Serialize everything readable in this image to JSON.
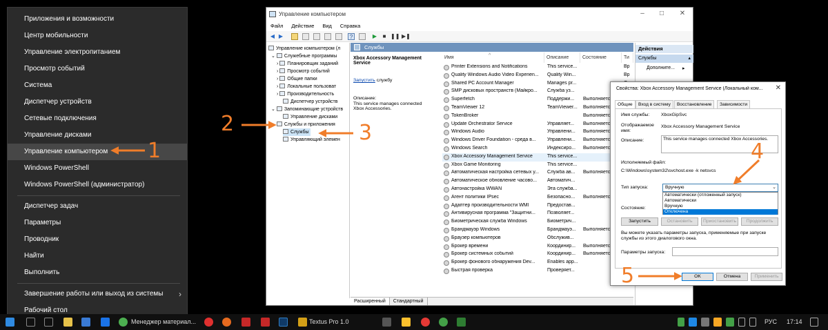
{
  "start_menu": {
    "items": [
      "Приложения и возможности",
      "Центр мобильности",
      "Управление электропитанием",
      "Просмотр событий",
      "Система",
      "Диспетчер устройств",
      "Сетевые подключения",
      "Управление дисками",
      "Управление компьютером",
      "Windows PowerShell",
      "Windows PowerShell (администратор)",
      "Диспетчер задач",
      "Параметры",
      "Проводник",
      "Найти",
      "Выполнить",
      "Завершение работы или выход из системы",
      "Рабочий стол"
    ],
    "active_index": 8
  },
  "window": {
    "title": "Управление компьютером",
    "menu": [
      "Файл",
      "Действие",
      "Вид",
      "Справка"
    ],
    "tree": [
      "Управление компьютером (л",
      "Служебные программы",
      "Планировщик заданий",
      "Просмотр событий",
      "Общие папки",
      "Локальные пользоват",
      "Производительность",
      "Диспетчер устройств",
      "Запоминающие устройств",
      "Управление дисками",
      "Службы и приложения",
      "Службы",
      "Управляющий элемен"
    ],
    "pane_title": "Службы",
    "selected_service_title": "Xbox Accessory Management Service",
    "start_link": "Запустить",
    "start_link_suffix": "службу",
    "description_label": "Описание:",
    "description_text": "This service manages connected Xbox Accessories.",
    "columns": [
      "Имя",
      "Описание",
      "Состояние",
      "Ти"
    ],
    "services": [
      {
        "name": "Printer Extensions and Notifications",
        "desc": "This service...",
        "state": "",
        "type": "Вр"
      },
      {
        "name": "Quality Windows Audio Video Experien...",
        "desc": "Quality Win...",
        "state": "",
        "type": "Вр"
      },
      {
        "name": "Shared PC Account Manager",
        "desc": "Manages pr...",
        "state": "",
        "type": "От"
      },
      {
        "name": "SMP дисковых пространств (Майкро...",
        "desc": "Служба уз...",
        "state": "",
        "type": "Вр"
      },
      {
        "name": "Superfetch",
        "desc": "Поддержи...",
        "state": "Выполняется",
        "type": ""
      },
      {
        "name": "TeamViewer 12",
        "desc": "TeamViewer...",
        "state": "Выполняется",
        "type": ""
      },
      {
        "name": "TokenBroker",
        "desc": "",
        "state": "Выполняется",
        "type": ""
      },
      {
        "name": "Update Orchestrator Service",
        "desc": "Управляет...",
        "state": "Выполняется",
        "type": ""
      },
      {
        "name": "Windows Audio",
        "desc": "Управлени...",
        "state": "Выполняется",
        "type": ""
      },
      {
        "name": "Windows Driver Foundation - среда в...",
        "desc": "Управлени...",
        "state": "Выполняется",
        "type": ""
      },
      {
        "name": "Windows Search",
        "desc": "Индексиро...",
        "state": "Выполняется",
        "type": ""
      },
      {
        "name": "Xbox Accessory Management Service",
        "desc": "This service...",
        "state": "",
        "type": ""
      },
      {
        "name": "Xbox Game Monitoring",
        "desc": "This service...",
        "state": "",
        "type": ""
      },
      {
        "name": "Автоматическая настройка сетевых у...",
        "desc": "Служба ав...",
        "state": "Выполняется",
        "type": ""
      },
      {
        "name": "Автоматическое обновление часово...",
        "desc": "Автоматич...",
        "state": "",
        "type": ""
      },
      {
        "name": "Автонастройка WWAN",
        "desc": "Эта служба...",
        "state": "",
        "type": ""
      },
      {
        "name": "Агент политики IPsec",
        "desc": "Безопасно...",
        "state": "Выполняется",
        "type": ""
      },
      {
        "name": "Адаптер производительности WMI",
        "desc": "Предостав...",
        "state": "",
        "type": ""
      },
      {
        "name": "Антивирусная программа \"Защитни...",
        "desc": "Позволяет...",
        "state": "",
        "type": ""
      },
      {
        "name": "Биометрическая служба Windows",
        "desc": "Биометрич...",
        "state": "",
        "type": ""
      },
      {
        "name": "Брандмауэр Windows",
        "desc": "Брандмауэ...",
        "state": "Выполняется",
        "type": ""
      },
      {
        "name": "Браузер компьютеров",
        "desc": "Обслужив...",
        "state": "",
        "type": ""
      },
      {
        "name": "Брокер времени",
        "desc": "Координир...",
        "state": "Выполняется",
        "type": ""
      },
      {
        "name": "Брокер системных событий",
        "desc": "Координир...",
        "state": "Выполняется",
        "type": ""
      },
      {
        "name": "Брокер фонового обнаружения Dev...",
        "desc": "Enables app...",
        "state": "",
        "type": ""
      },
      {
        "name": "Быстрая проверка",
        "desc": "Проверяет...",
        "state": "",
        "type": ""
      }
    ],
    "bottom_tabs": [
      "Расширенный",
      "Стандартный"
    ],
    "actions": {
      "header": "Действия",
      "sub": "Службы",
      "more": "Дополните..."
    }
  },
  "dialog": {
    "title": "Свойства: Xbox Accessory Management Service (Локальный ком...",
    "tabs": [
      "Общие",
      "Вход в систему",
      "Восстановление",
      "Зависимости"
    ],
    "service_name_label": "Имя службы:",
    "service_name": "XboxGipSvc",
    "display_name_label": "Отображаемое имя:",
    "display_name": "Xbox Accessory Management Service",
    "description_label": "Описание:",
    "description": "This service manages connected Xbox Accessories.",
    "exe_label": "Исполняемый файл:",
    "exe_path": "C:\\Windows\\system32\\svchost.exe -k netsvcs",
    "startup_label": "Тип запуска:",
    "startup_value": "Вручную",
    "startup_options": [
      "Автоматически (отложенный запуск)",
      "Автоматически",
      "Вручную",
      "Отключена"
    ],
    "startup_highlight": 3,
    "state_label": "Состояние:",
    "buttons": [
      "Запустить",
      "Остановить",
      "Приостановить",
      "Продолжить"
    ],
    "hint": "Вы можете указать параметры запуска, применяемые при запуске службы из этого диалогового окна.",
    "params_label": "Параметры запуска:",
    "ok": "OK",
    "cancel": "Отмена",
    "apply": "Применить"
  },
  "annotations": [
    "1",
    "2",
    "3",
    "4",
    "5"
  ],
  "taskbar": {
    "app1": "Менеджер материал...",
    "textus": "Textus Pro 1.0",
    "lang": "РУС",
    "time": "17:14"
  },
  "colors": {
    "accent": "#f07d2a",
    "highlight": "#0078d7"
  }
}
